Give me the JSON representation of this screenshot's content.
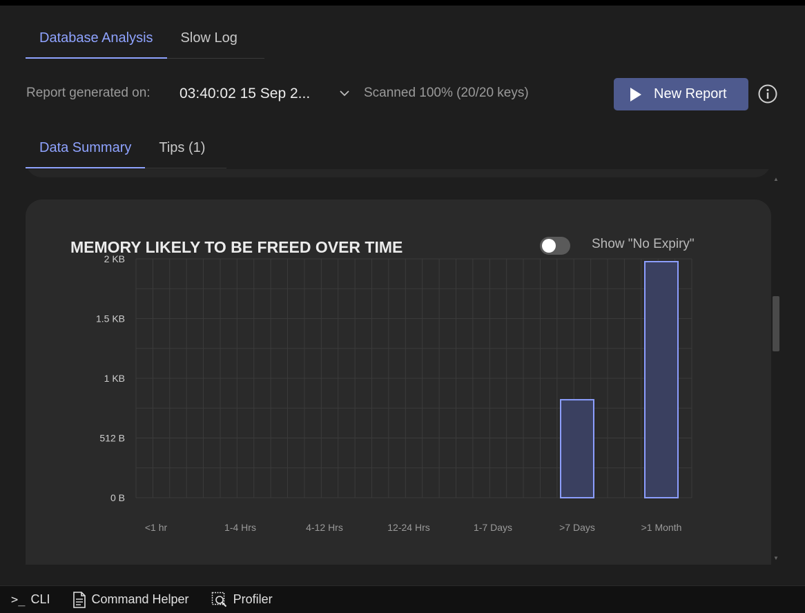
{
  "main_tabs": [
    {
      "label": "Database Analysis",
      "active": true
    },
    {
      "label": "Slow Log",
      "active": false
    }
  ],
  "report": {
    "generated_label": "Report generated on:",
    "generated_value": "03:40:02 15 Sep 2...",
    "scanned": "Scanned 100% (20/20 keys)",
    "new_report_label": "New Report",
    "icons": {
      "dropdown": "chevron-down-icon",
      "play": "play-icon",
      "info": "info-icon"
    }
  },
  "sub_tabs": [
    {
      "label": "Data Summary",
      "active": true
    },
    {
      "label": "Tips (1)",
      "active": false
    }
  ],
  "card": {
    "title": "MEMORY LIKELY TO BE FREED OVER TIME",
    "toggle_label": "Show \"No Expiry\"",
    "toggle_on": false
  },
  "chart_data": {
    "type": "bar",
    "title": "MEMORY LIKELY TO BE FREED OVER TIME",
    "categories": [
      "<1 hr",
      "1-4 Hrs",
      "4-12 Hrs",
      "12-24 Hrs",
      "1-7 Days",
      ">7 Days",
      ">1 Month"
    ],
    "values": [
      0,
      0,
      0,
      0,
      0,
      840,
      2290
    ],
    "value_unit": "B",
    "yticks": [
      {
        "value": 0,
        "label": "0 B"
      },
      {
        "value": 512,
        "label": "512 B"
      },
      {
        "value": 1024,
        "label": "1 KB"
      },
      {
        "value": 1536,
        "label": "1.5 KB"
      },
      {
        "value": 2048,
        "label": "2 KB"
      }
    ],
    "ylim": [
      0,
      2048
    ],
    "grid": true,
    "colors": {
      "bar_stroke": "#8c9eff",
      "bar_fill": "#3a4060",
      "grid": "#3b3b3b"
    }
  },
  "bottom_bar": {
    "cli": {
      "glyph": ">_",
      "label": "CLI"
    },
    "command_helper": {
      "label": "Command Helper",
      "icon": "document-icon"
    },
    "profiler": {
      "label": "Profiler",
      "icon": "profiler-icon"
    }
  },
  "colors": {
    "accent": "#8fa3ff",
    "button": "#4e5a8e",
    "background": "#1e1e1e",
    "card": "#2a2a2a"
  }
}
